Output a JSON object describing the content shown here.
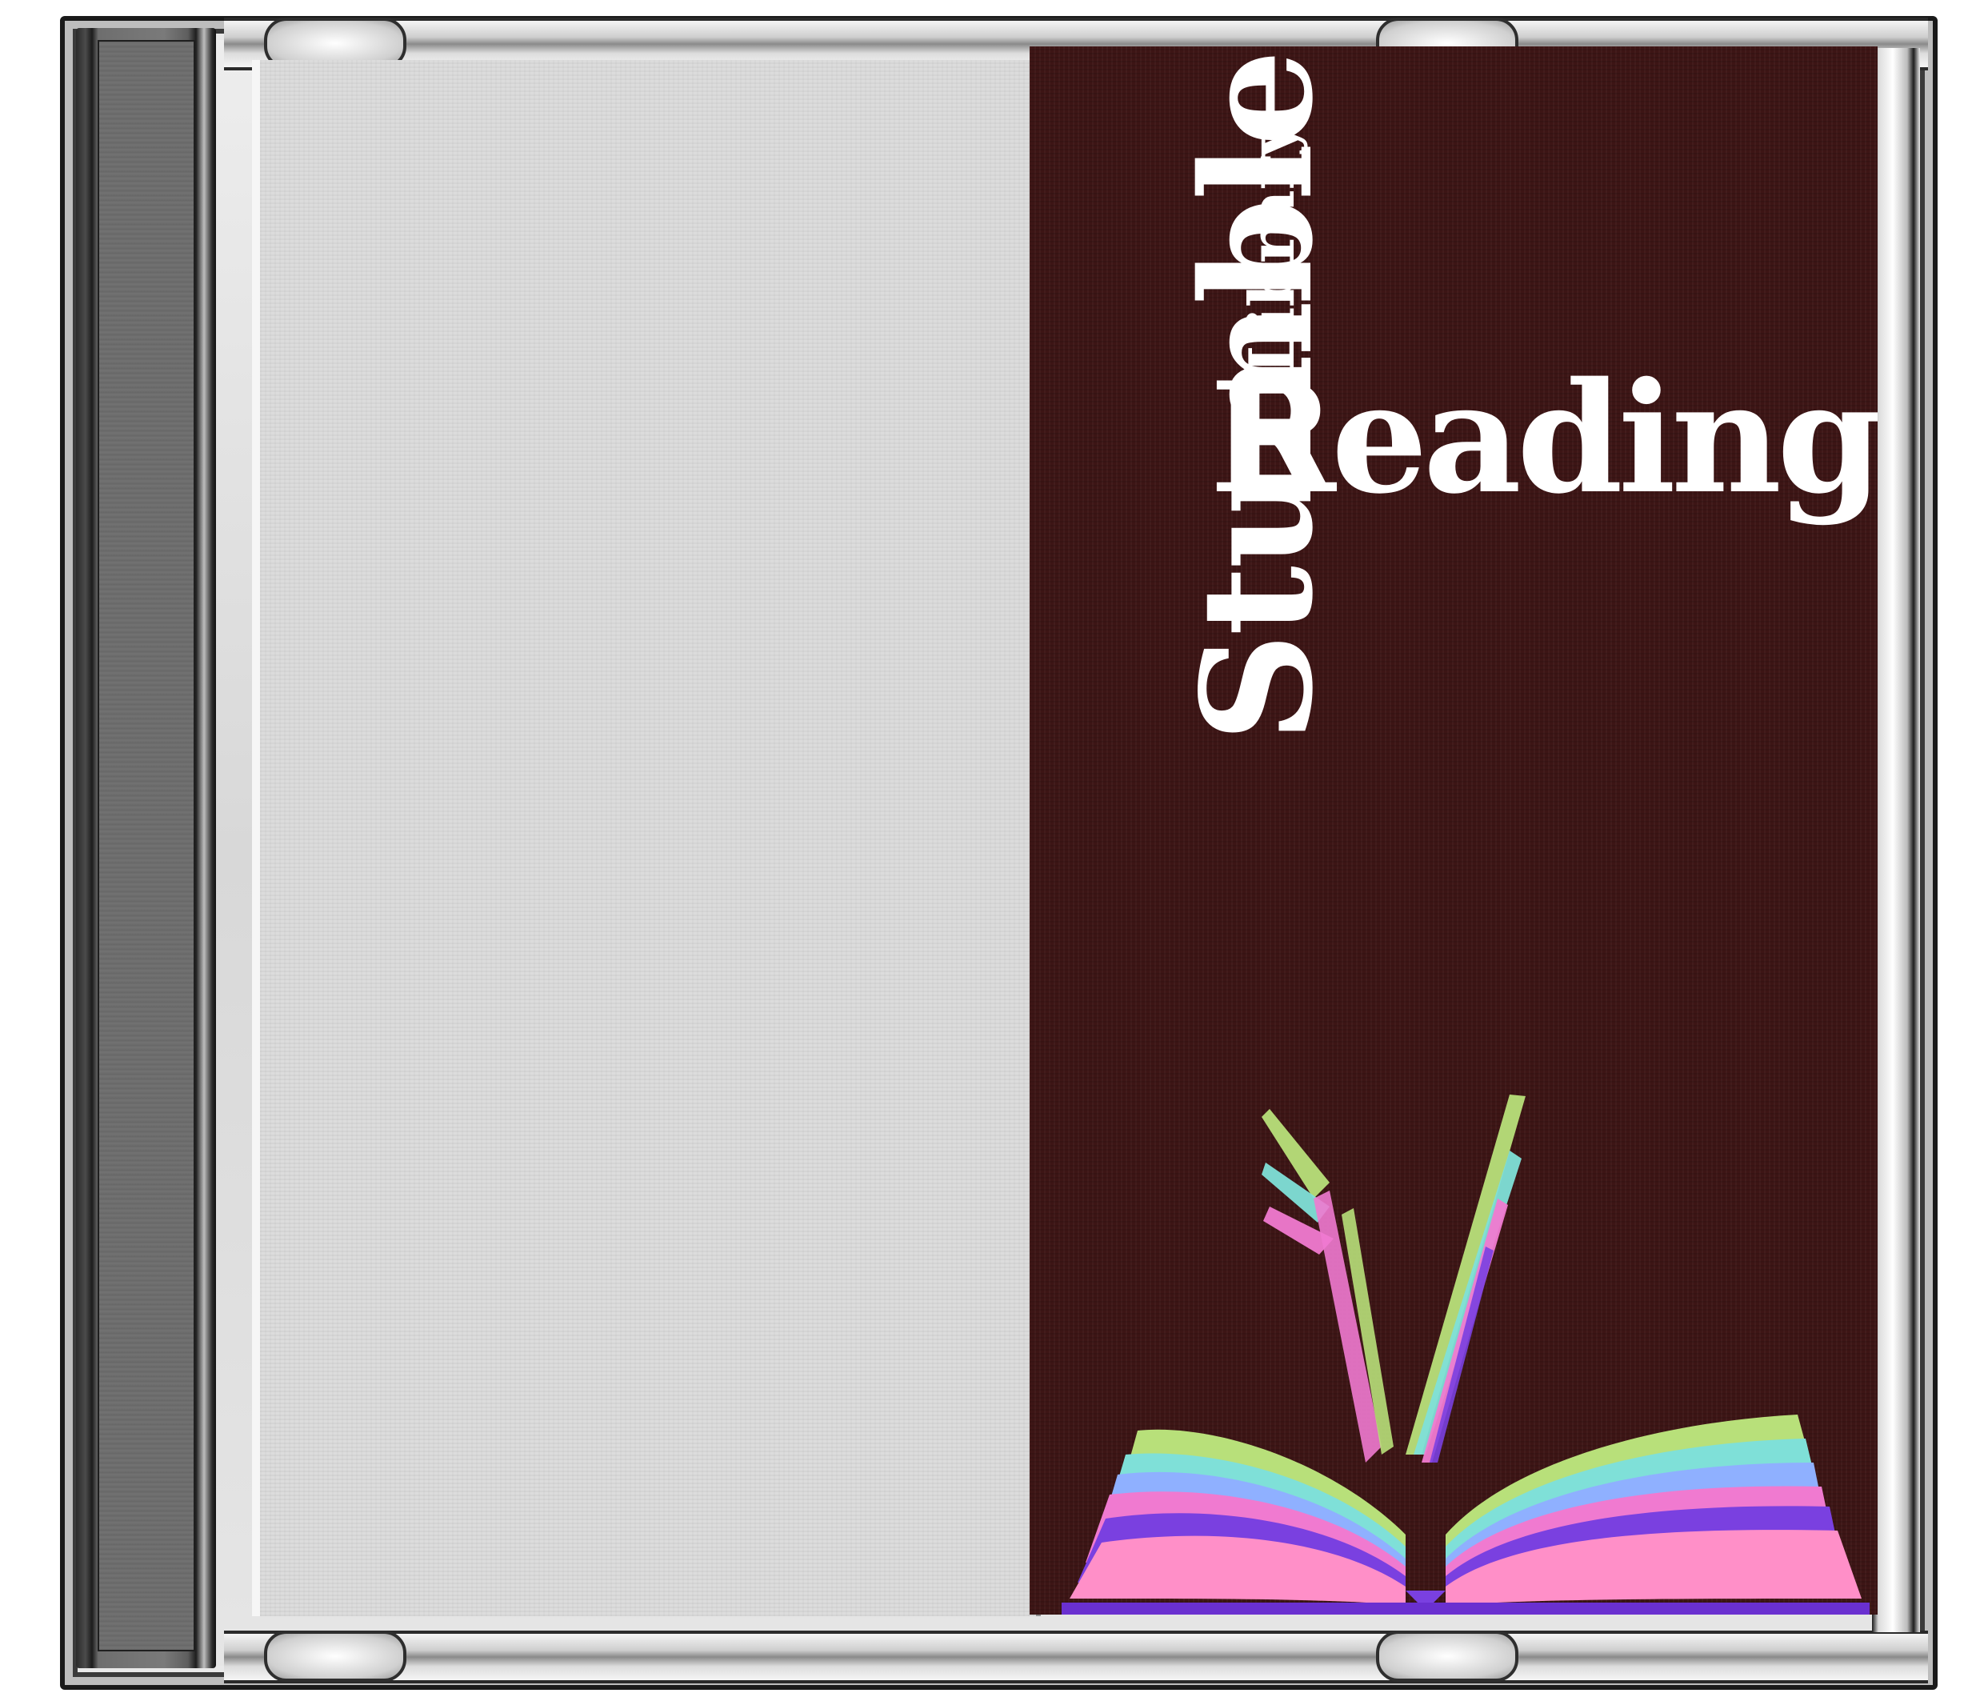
{
  "cover": {
    "title_line1": "Stumble",
    "title_line2": "Library",
    "title_line3": "Reading",
    "background_color": "#3d1515",
    "text_color": "#ffffff"
  },
  "left_panel": {
    "color": "#dcdcdc"
  },
  "illustration": {
    "icon": "open-book-icon",
    "page_colors": [
      "#b8e07a",
      "#7fe0d8",
      "#8fb0ff",
      "#f07ad0",
      "#7a40e0",
      "#ff8fc8"
    ]
  }
}
